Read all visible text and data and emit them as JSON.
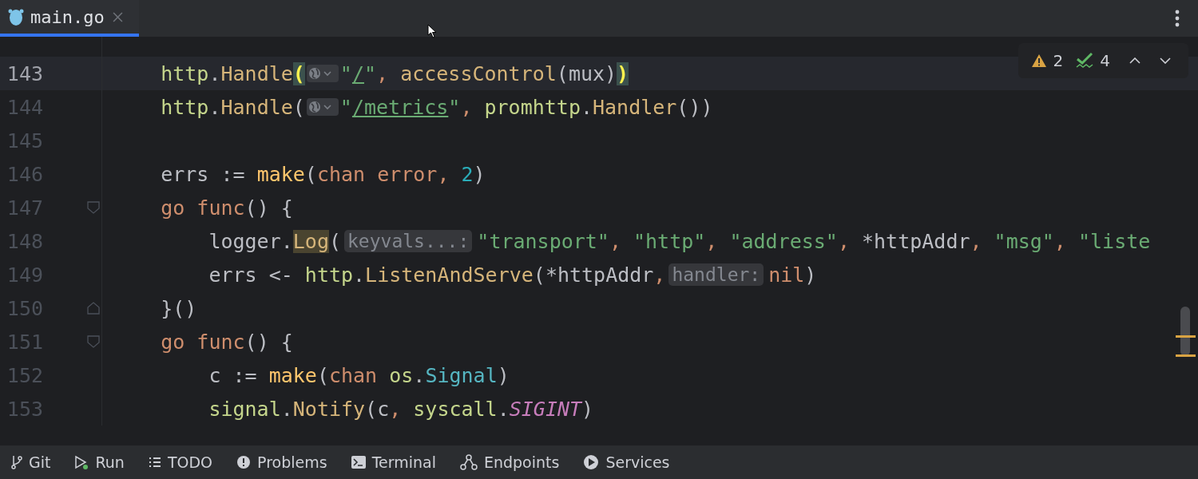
{
  "tabs": [
    {
      "label": "main.go",
      "selected": true
    }
  ],
  "inspections": {
    "warnings": "2",
    "checks": "4"
  },
  "lines": [
    {
      "current": false,
      "fold_start": false,
      "fold_end": false
    },
    {
      "number": "143",
      "current": true,
      "fold_start": false,
      "fold_end": false,
      "tokens": [
        {
          "kind": "pkg",
          "text": "    http"
        },
        {
          "kind": "t",
          "text": "."
        },
        {
          "kind": "fn",
          "text": "Handle"
        },
        {
          "kind": "match",
          "text": "("
        },
        {
          "kind": "globe"
        },
        {
          "kind": "str",
          "text": "\""
        },
        {
          "kind": "url",
          "text": "/"
        },
        {
          "kind": "str",
          "text": "\""
        },
        {
          "kind": "comma",
          "text": ","
        },
        {
          "kind": "fn",
          "text": " accessControl"
        },
        {
          "kind": "t",
          "text": "(mux)"
        },
        {
          "kind": "match",
          "text": ")"
        }
      ]
    },
    {
      "number": "144",
      "current": false,
      "fold_start": false,
      "fold_end": false,
      "tokens": [
        {
          "kind": "pkg",
          "text": "    http"
        },
        {
          "kind": "t",
          "text": "."
        },
        {
          "kind": "fn",
          "text": "Handle"
        },
        {
          "kind": "t",
          "text": "("
        },
        {
          "kind": "globe"
        },
        {
          "kind": "str",
          "text": "\""
        },
        {
          "kind": "url",
          "text": "/metrics"
        },
        {
          "kind": "str",
          "text": "\""
        },
        {
          "kind": "comma",
          "text": ","
        },
        {
          "kind": "pkg",
          "text": " promhttp"
        },
        {
          "kind": "t",
          "text": "."
        },
        {
          "kind": "fn",
          "text": "Handler"
        },
        {
          "kind": "t",
          "text": "())"
        }
      ]
    },
    {
      "number": "145",
      "current": false,
      "fold_start": false,
      "fold_end": false
    },
    {
      "number": "146",
      "current": false,
      "fold_start": false,
      "fold_end": false,
      "tokens": [
        {
          "kind": "t",
          "text": "    errs := "
        },
        {
          "kind": "bi",
          "text": "make"
        },
        {
          "kind": "t",
          "text": "("
        },
        {
          "kind": "kw",
          "text": "chan error"
        },
        {
          "kind": "comma",
          "text": ","
        },
        {
          "kind": "num",
          "text": " 2"
        },
        {
          "kind": "t",
          "text": ")"
        }
      ]
    },
    {
      "number": "147",
      "current": false,
      "fold_start": true,
      "fold_end": false,
      "tokens": [
        {
          "kind": "kw",
          "text": "    go func"
        },
        {
          "kind": "t",
          "text": "() {"
        }
      ]
    },
    {
      "number": "148",
      "current": false,
      "fold_start": false,
      "fold_end": false,
      "tokens": [
        {
          "kind": "t",
          "text": "        logger."
        },
        {
          "kind": "usage",
          "text": "Log"
        },
        {
          "kind": "t",
          "text": "("
        },
        {
          "kind": "hint",
          "text": "keyvals...:"
        },
        {
          "kind": "str",
          "text": "\"transport\""
        },
        {
          "kind": "comma",
          "text": ","
        },
        {
          "kind": "str",
          "text": " \"http\""
        },
        {
          "kind": "comma",
          "text": ","
        },
        {
          "kind": "str",
          "text": " \"address\""
        },
        {
          "kind": "comma",
          "text": ","
        },
        {
          "kind": "t",
          "text": " *httpAddr"
        },
        {
          "kind": "comma",
          "text": ","
        },
        {
          "kind": "str",
          "text": " \"msg\""
        },
        {
          "kind": "comma",
          "text": ","
        },
        {
          "kind": "str",
          "text": " \"liste"
        }
      ]
    },
    {
      "number": "149",
      "current": false,
      "fold_start": false,
      "fold_end": false,
      "tokens": [
        {
          "kind": "t",
          "text": "        errs <- "
        },
        {
          "kind": "pkg",
          "text": "http"
        },
        {
          "kind": "t",
          "text": "."
        },
        {
          "kind": "fn",
          "text": "ListenAndServe"
        },
        {
          "kind": "t",
          "text": "(*httpAddr"
        },
        {
          "kind": "comma",
          "text": ","
        },
        {
          "kind": "hint",
          "text": "handler:"
        },
        {
          "kind": "kw",
          "text": "nil"
        },
        {
          "kind": "t",
          "text": ")"
        }
      ]
    },
    {
      "number": "150",
      "current": false,
      "fold_start": false,
      "fold_end": true,
      "tokens": [
        {
          "kind": "t",
          "text": "    }()"
        }
      ]
    },
    {
      "number": "151",
      "current": false,
      "fold_start": true,
      "fold_end": false,
      "tokens": [
        {
          "kind": "kw",
          "text": "    go func"
        },
        {
          "kind": "t",
          "text": "() {"
        }
      ]
    },
    {
      "number": "152",
      "current": false,
      "fold_start": false,
      "fold_end": false,
      "tokens": [
        {
          "kind": "t",
          "text": "        c := "
        },
        {
          "kind": "bi",
          "text": "make"
        },
        {
          "kind": "t",
          "text": "("
        },
        {
          "kind": "kw",
          "text": "chan"
        },
        {
          "kind": "pkg",
          "text": " os"
        },
        {
          "kind": "t",
          "text": "."
        },
        {
          "kind": "ty",
          "text": "Signal"
        },
        {
          "kind": "t",
          "text": ")"
        }
      ]
    },
    {
      "number": "153",
      "current": false,
      "fold_start": false,
      "fold_end": false,
      "tokens": [
        {
          "kind": "pkg",
          "text": "        signal"
        },
        {
          "kind": "t",
          "text": "."
        },
        {
          "kind": "fn",
          "text": "Notify"
        },
        {
          "kind": "t",
          "text": "(c"
        },
        {
          "kind": "comma",
          "text": ","
        },
        {
          "kind": "pkg",
          "text": " syscall"
        },
        {
          "kind": "t",
          "text": "."
        },
        {
          "kind": "cn",
          "text": "SIGINT"
        },
        {
          "kind": "t",
          "text": ")"
        }
      ]
    }
  ],
  "status_bar": [
    {
      "label": "Git",
      "kind": "git"
    },
    {
      "label": "Run",
      "kind": "run"
    },
    {
      "label": "TODO",
      "kind": "todo"
    },
    {
      "label": "Problems",
      "kind": "problems"
    },
    {
      "label": "Terminal",
      "kind": "terminal"
    },
    {
      "label": "Endpoints",
      "kind": "endpoints"
    },
    {
      "label": "Services",
      "kind": "services"
    }
  ]
}
